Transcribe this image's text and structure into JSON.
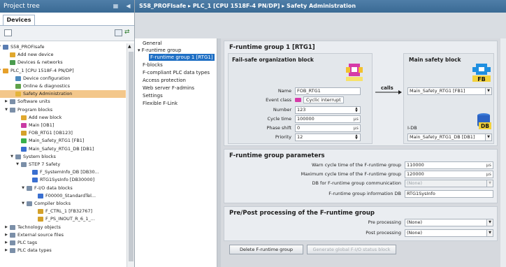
{
  "tree": {
    "title": "Project tree",
    "devices_tab": "Devices",
    "items": [
      {
        "label": "S58_PROFIsafe",
        "icon": "project-icon",
        "color": "#5a7db2"
      },
      {
        "label": "Add new device",
        "icon": "add-device-icon",
        "color": "#e0a82e"
      },
      {
        "label": "Devices & networks",
        "icon": "network-icon",
        "color": "#4a9c4e"
      },
      {
        "label": "PLC_1 [CPU 1518F-4 PN/DP]",
        "icon": "cpu-icon",
        "color": "#e6a02a"
      },
      {
        "label": "Device configuration",
        "icon": "device-config-icon",
        "color": "#4e8bbf"
      },
      {
        "label": "Online & diagnostics",
        "icon": "diagnostics-icon",
        "color": "#5fa24a"
      },
      {
        "label": "Safety Administration",
        "icon": "safety-icon",
        "color": "#e4b43a"
      },
      {
        "label": "Software units",
        "icon": "folder-icon",
        "color": "#7b8fa8"
      },
      {
        "label": "Program blocks",
        "icon": "folder-icon",
        "color": "#7b8fa8"
      },
      {
        "label": "Add new block",
        "icon": "add-block-icon",
        "color": "#e0a82e"
      },
      {
        "label": "Main [OB1]",
        "icon": "ob-icon",
        "color": "#c93aa4"
      },
      {
        "label": "FOB_RTG1 [OB123]",
        "icon": "fob-icon",
        "color": "#d4a12a"
      },
      {
        "label": "Main_Safety_RTG1 [FB1]",
        "icon": "fb-icon",
        "color": "#38b04a"
      },
      {
        "label": "Main_Safety_RTG1_DB [DB1]",
        "icon": "db-icon",
        "color": "#3a6fd0"
      },
      {
        "label": "System blocks",
        "icon": "folder-icon",
        "color": "#7b8fa8"
      },
      {
        "label": "STEP 7 Safety",
        "icon": "folder-icon",
        "color": "#7b8fa8"
      },
      {
        "label": "F_SystemInfo_DB [DB30...",
        "icon": "db-icon",
        "color": "#3a6fd0"
      },
      {
        "label": "RTG1SysInfo [DB30000]",
        "icon": "db-icon",
        "color": "#3a6fd0"
      },
      {
        "label": "F-I/O data blocks",
        "icon": "folder-icon",
        "color": "#7b8fa8"
      },
      {
        "label": "F00000_StandardTel...",
        "icon": "db-icon",
        "color": "#3a6fd0"
      },
      {
        "label": "Compiler blocks",
        "icon": "folder-icon",
        "color": "#7b8fa8"
      },
      {
        "label": "F_CTRL_1 [FB32767]",
        "icon": "fb-icon",
        "color": "#d4a12a"
      },
      {
        "label": "F_PS_INOUT_R_6_1_...",
        "icon": "fb-icon",
        "color": "#d4a12a"
      },
      {
        "label": "Technology objects",
        "icon": "folder-icon",
        "color": "#7b8fa8"
      },
      {
        "label": "External source files",
        "icon": "folder-icon",
        "color": "#7b8fa8"
      },
      {
        "label": "PLC tags",
        "icon": "folder-icon",
        "color": "#7b8fa8"
      },
      {
        "label": "PLC data types",
        "icon": "folder-icon",
        "color": "#7b8fa8"
      }
    ]
  },
  "breadcrumb": "S58_PROFIsafe  ▸  PLC_1 [CPU 1518F-4 PN/DP]  ▸  Safety Administration",
  "nav": {
    "items": [
      "General",
      "F-runtime group",
      "F-runtime group 1 [RTG1]",
      "F-blocks",
      "F-compliant PLC data types",
      "Access protection",
      "Web server F-admins",
      "Settings",
      "Flexible F-Link"
    ]
  },
  "group": {
    "title": "F-runtime group 1 [RTG1]",
    "fob_title": "Fail-safe organization block",
    "main_title": "Main safety block",
    "calls_label": "calls",
    "name_label": "Name",
    "name_value": "FOB_RTG1",
    "event_label": "Event class",
    "event_value": "Cyclic interrupt",
    "number_label": "Number",
    "number_value": "123",
    "cycle_label": "Cycle time",
    "cycle_value": "100000",
    "phase_label": "Phase shift",
    "phase_value": "0",
    "priority_label": "Priority",
    "priority_value": "12",
    "unit": "µs",
    "main_block_value": "Main_Safety_RTG1 [FB1]",
    "idb_label": "I-DB",
    "idb_value": "Main_Safety_RTG1_DB [DB1]",
    "fob_badge": "",
    "fb_badge": "FB",
    "db_badge": "DB"
  },
  "params": {
    "title": "F-runtime group parameters",
    "warn_label": "Warn cycle time of the F-runtime group",
    "warn_value": "110000",
    "max_label": "Maximum cycle time of the F-runtime group",
    "max_value": "120000",
    "db_comm_label": "DB for F-runtime group communication",
    "db_comm_value": "(None)",
    "info_db_label": "F-runtime group information DB",
    "info_db_value": "RTG1SysInfo"
  },
  "prepost": {
    "title": "Pre/Post processing of the F-runtime group",
    "pre_label": "Pre processing",
    "pre_value": "(None)",
    "post_label": "Post processing",
    "post_value": "(None)"
  },
  "buttons": {
    "delete": "Delete F-runtime group",
    "generate": "Generate global F-I/O status block"
  }
}
